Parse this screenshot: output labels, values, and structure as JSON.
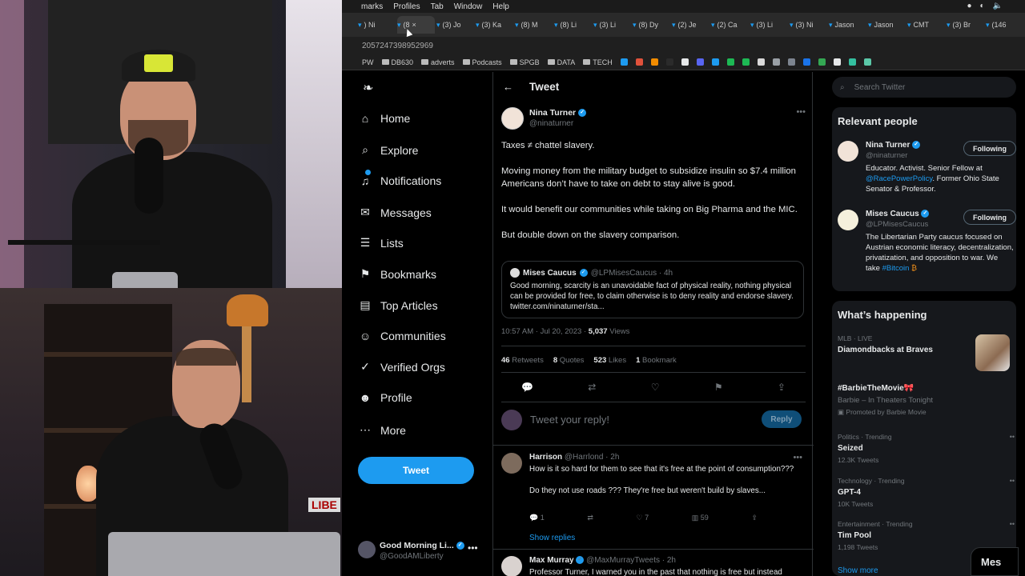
{
  "menubar": {
    "items": [
      "marks",
      "Profiles",
      "Tab",
      "Window",
      "Help"
    ]
  },
  "tabs": [
    {
      "label": ") Ni",
      "active": false
    },
    {
      "label": "(8",
      "active": true
    },
    {
      "label": "(3) Jo",
      "active": false
    },
    {
      "label": "(3) Ka",
      "active": false
    },
    {
      "label": "(8) M",
      "active": false
    },
    {
      "label": "(8) Li",
      "active": false
    },
    {
      "label": "(3) Li",
      "active": false
    },
    {
      "label": "(8) Dy",
      "active": false
    },
    {
      "label": "(2) Je",
      "active": false
    },
    {
      "label": "(2) Ca",
      "active": false
    },
    {
      "label": "(3) Li",
      "active": false
    },
    {
      "label": "(3) Ni",
      "active": false
    },
    {
      "label": "Jason",
      "active": false
    },
    {
      "label": "Jason",
      "active": false
    },
    {
      "label": "CMT",
      "active": false
    },
    {
      "label": "(3) Br",
      "active": false
    },
    {
      "label": "(146",
      "active": false
    }
  ],
  "url": "2057247398952969",
  "bookmarks": [
    {
      "label": "PW",
      "type": "text"
    },
    {
      "label": "DB630",
      "type": "folder"
    },
    {
      "label": "adverts",
      "type": "folder"
    },
    {
      "label": "Podcasts",
      "type": "folder"
    },
    {
      "label": "SPGB",
      "type": "folder"
    },
    {
      "label": "DATA",
      "type": "folder"
    },
    {
      "label": "TECH",
      "type": "folder"
    }
  ],
  "bookmark_icon_colors": [
    "#1d9bf0",
    "#e0513b",
    "#f28c00",
    "#2b2b2b",
    "#e7e9ea",
    "#5865f2",
    "#1d9bf0",
    "#1db954",
    "#1db954",
    "#d9d9d9",
    "#9aa0a6",
    "#7d8590",
    "#1a73e8",
    "#34a853",
    "#e7e9ea",
    "#34c0a0",
    "#5bc8a8"
  ],
  "nav": {
    "items": [
      {
        "label": "Home",
        "icon": "home-icon"
      },
      {
        "label": "Explore",
        "icon": "search-icon"
      },
      {
        "label": "Notifications",
        "icon": "bell-icon"
      },
      {
        "label": "Messages",
        "icon": "envelope-icon"
      },
      {
        "label": "Lists",
        "icon": "list-icon"
      },
      {
        "label": "Bookmarks",
        "icon": "bookmark-icon"
      },
      {
        "label": "Top Articles",
        "icon": "articles-icon"
      },
      {
        "label": "Communities",
        "icon": "communities-icon"
      },
      {
        "label": "Verified Orgs",
        "icon": "verified-icon"
      },
      {
        "label": "Profile",
        "icon": "person-icon"
      },
      {
        "label": "More",
        "icon": "more-icon"
      }
    ],
    "tweet_button": "Tweet",
    "account": {
      "name": "Good Morning Li...",
      "handle": "@GoodAMLiberty"
    }
  },
  "header": {
    "title": "Tweet"
  },
  "tweet": {
    "author_name": "Nina Turner",
    "author_handle": "@ninaturner",
    "paragraphs": [
      "Taxes ≠ chattel slavery.",
      "Moving money from the military budget to subsidize insulin so $7.4 million Americans don’t have to take on debt to stay alive is good.",
      "It would benefit our communities while taking on Big Pharma and the MIC.",
      "But double down on the slavery comparison."
    ],
    "quote": {
      "name": "Mises Caucus",
      "handle": "@LPMisesCaucus · 4h",
      "text": "Good morning, scarcity is an unavoidable fact of physical reality, nothing physical can be provided for free, to claim otherwise is to deny reality and endorse slavery. twitter.com/ninaturner/sta..."
    },
    "time": "10:57 AM · Jul 20, 2023 · ",
    "views_count": "5,037",
    "views_label": " Views",
    "stats": [
      {
        "count": "46",
        "label": "Retweets"
      },
      {
        "count": "8",
        "label": "Quotes"
      },
      {
        "count": "523",
        "label": "Likes"
      },
      {
        "count": "1",
        "label": "Bookmark"
      }
    ]
  },
  "reply_box": {
    "placeholder": "Tweet your reply!",
    "button": "Reply"
  },
  "replies": [
    {
      "name": "Harrison",
      "handle": " @Harrlond · 2h",
      "paragraphs": [
        "How is it so hard for them to see that it's free at the point of consumption???",
        "Do they not use roads ??? They're free but weren't build by slaves..."
      ],
      "reply_count": "1",
      "like_count": "7",
      "view_count": "59"
    },
    {
      "name": "Max Murray",
      "handle": " @MaxMurrayTweets · 2h",
      "paragraphs": [
        "Professor Turner, I warned you in the past that nothing is free but instead"
      ]
    }
  ],
  "show_replies": "Show replies",
  "search": {
    "placeholder": "Search Twitter"
  },
  "relevant": {
    "title": "Relevant people",
    "people": [
      {
        "name": "Nina Turner",
        "handle": "@ninaturner",
        "button": "Following",
        "bio": "Educator. Activist. Senior Fellow at ",
        "bio_link": "@RacePowerPolicy",
        "bio_tail": ". Former Ohio State Senator & Professor."
      },
      {
        "name": "Mises Caucus",
        "handle": "@LPMisesCaucus",
        "button": "Following",
        "bio": "The Libertarian Party caucus focused on Austrian economic literacy, decentralization, privatization, and opposition to war. We take ",
        "bio_link": "#Bitcoin",
        "bio_tail": " ₿"
      }
    ]
  },
  "happening": {
    "title": "What’s happening",
    "trends": [
      {
        "category": "MLB · LIVE",
        "title": "Diamondbacks at Braves",
        "count": ""
      },
      {
        "category": "",
        "title": "#BarbieTheMovie🎀",
        "count": "Barbie – In Theaters Tonight",
        "promo": "Promoted by Barbie Movie"
      },
      {
        "category": "Politics · Trending",
        "title": "Seized",
        "count": "12.3K Tweets"
      },
      {
        "category": "Technology · Trending",
        "title": "GPT-4",
        "count": "10K Tweets"
      },
      {
        "category": "Entertainment · Trending",
        "title": "Tim Pool",
        "count": "1,198 Tweets"
      }
    ],
    "show_more": "Show more"
  },
  "messages_dock": {
    "label": "Mes"
  },
  "webcam": {
    "sign": "LIBE"
  }
}
